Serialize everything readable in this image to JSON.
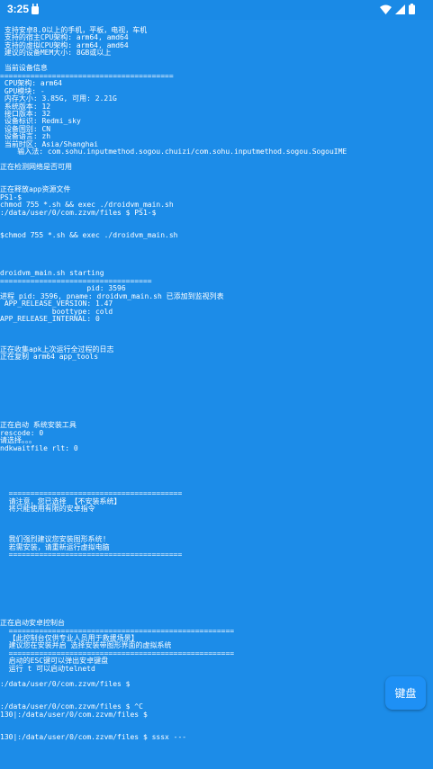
{
  "status_bar": {
    "time": "3:25",
    "left_icon": "android-debug-icon",
    "right_icons": [
      "wifi-icon",
      "signal-icon",
      "battery-icon"
    ]
  },
  "terminal": {
    "lines": [
      " 支持安卓8.0以上的手机，平板，电视，车机",
      " 支持的宿主CPU架构: arm64, amd64",
      " 支持的虚拟CPU架构: arm64, amd64",
      " 建议的设备MEM大小: 8GB或以上",
      "",
      " 当前设备信息",
      "========================================",
      " CPU架构: arm64",
      " GPU模块: -",
      " 内存大小: 3.85G, 可用: 2.21G",
      " 系统版本: 12",
      " 接口版本: 32",
      " 设备标识: Redmi_sky",
      " 设备国别: CN",
      " 设备语言: zh",
      " 当前时区: Asia/Shanghai",
      "    输入法: com.sohu.inputmethod.sogou.chuizi/com.sohu.inputmethod.sogou.SogouIME",
      "",
      "正在检测网络是否可用",
      "",
      "",
      "正在释放app资源文件",
      "PS1-$",
      "chmod 755 *.sh && exec ./droidvm_main.sh",
      ":/data/user/0/com.zzvm/files $ PS1-$",
      "",
      "",
      "$chmod 755 *.sh && exec ./droidvm_main.sh",
      "",
      "",
      "",
      "",
      "droidvm_main.sh starting",
      "===================================",
      "                    pid: 3596",
      "进程 pid: 3596, pname: droidvm_main.sh 已添加到监视列表",
      " APP_RELEASE_VERSION: 1.47",
      "            boottype: cold",
      "APP_RELEASE_INTERNAL: 0",
      "",
      "",
      "",
      "正在收集apk上次运行全过程的日志",
      "正在复制 arm64 app_tools",
      "",
      "",
      "",
      "",
      "",
      "",
      "",
      "",
      "正在启动 系统安装工具",
      "rescode: 0",
      "请选择。。。",
      "ndkwaitfile rlt: 0",
      "",
      "",
      "",
      "",
      "",
      "  ========================================",
      "  请注意，您已选择 【不安装系统】",
      "  将只能使用有限的安卓指令",
      "",
      "",
      "",
      "  我们强烈建议您安装图形系统!",
      "  若需安装，请重新运行虚拟电脑",
      "  ========================================",
      "",
      "",
      "",
      "",
      "",
      "",
      "",
      "",
      "正在启动安卓控制台",
      "  ====================================================",
      "  【此控制台仅供专业人员用于救援场景】",
      "  建议您在安装并启 选择安装带图形界面的虚拟系统",
      "  ====================================================",
      "  启动的ESC键可以弹出安卓键盘",
      "  运行 t 可以启动telnetd",
      "",
      ":/data/user/0/com.zzvm/files $",
      "",
      "",
      ":/data/user/0/com.zzvm/files $ ^C",
      "130|:/data/user/0/com.zzvm/files $",
      "",
      "",
      "130|:/data/user/0/com.zzvm/files $ sssx ---"
    ],
    "tops": []
  },
  "keyboard_button": {
    "label": "键盘"
  },
  "colors": {
    "background": "#1c8ce8",
    "text": "#ffffff",
    "button": "#1e90f5"
  }
}
